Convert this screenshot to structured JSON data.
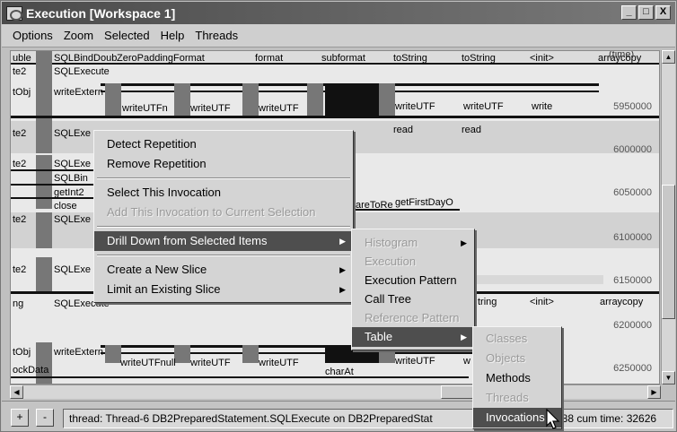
{
  "window": {
    "title": "Execution  [Workspace 1]",
    "buttons": [
      "_",
      "□",
      "X"
    ]
  },
  "menubar": [
    "Options",
    "Zoom",
    "Selected",
    "Help",
    "Threads"
  ],
  "timeline": {
    "time_header": "(time)",
    "ticks": [
      "5950000",
      "6000000",
      "6050000",
      "6100000",
      "6150000",
      "6200000",
      "6250000"
    ],
    "rows": [
      {
        "labels": [
          "uble",
          "SQLBindDoub",
          "ZeroPaddingFormat",
          "format",
          "subformat",
          "toString",
          "toString",
          "<init>",
          "arraycopy"
        ]
      },
      {
        "labels": [
          "te2",
          "SQLExecute"
        ]
      },
      {
        "labels": [
          "tObj",
          "writeExtern",
          "writeUTFn",
          "writeUTF",
          "writeUTF",
          "writeUTF",
          "writeUTF",
          "write"
        ]
      },
      {
        "labels": [
          "te2",
          "SQLExe",
          "read",
          "read"
        ]
      },
      {
        "labels": [
          "te2",
          "SQLExe",
          "SQLBin",
          "getInt2",
          "close"
        ]
      },
      {
        "labels": [
          "areToRe",
          "getFirstDayO"
        ]
      },
      {
        "labels": [
          "te2",
          "SQLExe"
        ]
      },
      {
        "labels": [
          "te2",
          "SQLExe"
        ]
      },
      {
        "labels": [
          "ng",
          "SQLExecute",
          "tring",
          "<init>",
          "arraycopy"
        ]
      },
      {
        "labels": [
          "tObj",
          "writeExtern",
          "writeUTFnull",
          "writeUTF",
          "writeUTF",
          "charAt",
          "writeUTF",
          "w"
        ]
      },
      {
        "labels": [
          "ockData"
        ]
      }
    ]
  },
  "context_menu": {
    "items": [
      {
        "label": "Detect Repetition",
        "enabled": true
      },
      {
        "label": "Remove Repetition",
        "enabled": true
      },
      {
        "label": "Select This Invocation",
        "enabled": true
      },
      {
        "label": "Add This Invocation to Current Selection",
        "enabled": false
      },
      {
        "label": "Drill Down from Selected Items",
        "enabled": true,
        "submenu": true,
        "selected": true
      },
      {
        "label": "Create a New Slice",
        "enabled": true,
        "submenu": true
      },
      {
        "label": "Limit an Existing Slice",
        "enabled": true,
        "submenu": true
      }
    ]
  },
  "drill_menu": {
    "items": [
      {
        "label": "Histogram",
        "enabled": false,
        "submenu": true
      },
      {
        "label": "Execution",
        "enabled": false
      },
      {
        "label": "Execution Pattern",
        "enabled": true
      },
      {
        "label": "Call Tree",
        "enabled": true
      },
      {
        "label": "Reference Pattern",
        "enabled": false
      },
      {
        "label": "Table",
        "enabled": true,
        "submenu": true,
        "selected": true
      }
    ]
  },
  "table_menu": {
    "items": [
      {
        "label": "Classes",
        "enabled": false
      },
      {
        "label": "Objects",
        "enabled": false
      },
      {
        "label": "Methods",
        "enabled": true
      },
      {
        "label": "Threads",
        "enabled": false
      },
      {
        "label": "Invocations",
        "enabled": true,
        "selected": true
      }
    ]
  },
  "statusbar": {
    "plus": "+",
    "minus": "-",
    "text": "thread: Thread-6  DB2PreparedStatement.SQLExecute  on  DB2PreparedStat",
    "tail": "388 cum time: 32626"
  }
}
